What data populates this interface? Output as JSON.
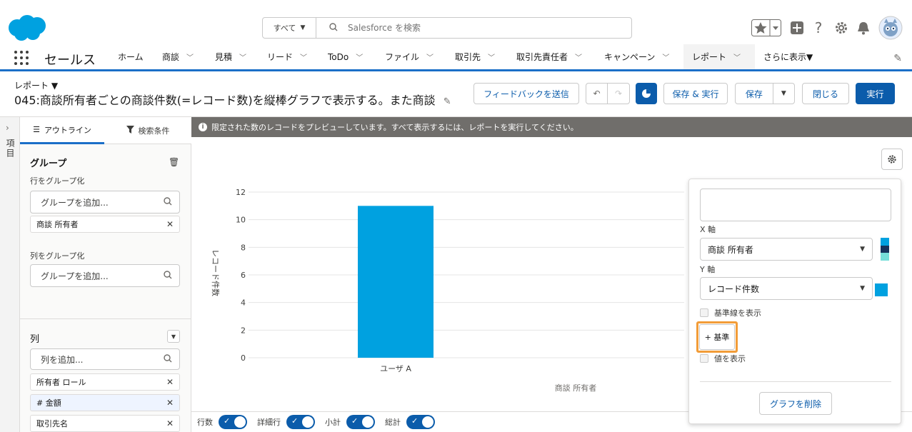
{
  "header": {
    "search_scope": "すべて",
    "search_placeholder": "Salesforce を検索"
  },
  "nav": {
    "app_name": "セールス",
    "items": [
      {
        "label": "ホーム",
        "chevron": false
      },
      {
        "label": "商談",
        "chevron": true
      },
      {
        "label": "見積",
        "chevron": true
      },
      {
        "label": "リード",
        "chevron": true
      },
      {
        "label": "ToDo",
        "chevron": true
      },
      {
        "label": "ファイル",
        "chevron": true
      },
      {
        "label": "取引先",
        "chevron": true
      },
      {
        "label": "取引先責任者",
        "chevron": true
      },
      {
        "label": "キャンペーン",
        "chevron": true
      },
      {
        "label": "レポート",
        "chevron": true,
        "active": true
      },
      {
        "label": "さらに表示▼",
        "chevron": false
      }
    ]
  },
  "report": {
    "type_label": "レポート ▼",
    "title": "045:商談所有者ごとの商談件数(=レコード数)を縦棒グラフで表示する。また商談"
  },
  "toolbar": {
    "feedback": "フィードバックを送信",
    "save_run": "保存 & 実行",
    "save": "保存",
    "close": "閉じる",
    "run": "実行"
  },
  "left_rail": {
    "label": "項目"
  },
  "side_panel": {
    "tab_outline": "アウトライン",
    "tab_filters": "検索条件",
    "group_title": "グループ",
    "row_group_label": "行をグループ化",
    "add_group_placeholder": "グループを追加...",
    "row_groups": [
      "商談 所有者"
    ],
    "col_group_label": "列をグループ化",
    "columns_title": "列",
    "add_column_placeholder": "列を追加...",
    "columns": [
      "所有者 ロール",
      "# 金額",
      "取引先名"
    ]
  },
  "main": {
    "banner": "限定された数のレコードをプレビューしています。すべて表示するには、レポートを実行してください。"
  },
  "bottom": {
    "toggles": [
      "行数",
      "詳細行",
      "小計",
      "総計"
    ]
  },
  "chart_panel": {
    "x_axis_label": "X 軸",
    "x_axis_value": "商談 所有者",
    "y_axis_label": "Y 軸",
    "y_axis_value": "レコード件数",
    "show_baseline": "基準線を表示",
    "add_baseline": "+ 基準",
    "show_values": "値を表示",
    "delete_chart": "グラフを削除",
    "x_colors": [
      "#00a1e0",
      "#16325c",
      "#76ded9"
    ],
    "y_color": "#00a1e0"
  },
  "chart_data": {
    "type": "bar",
    "categories": [
      "ユーザ A"
    ],
    "values": [
      11
    ],
    "ylim": [
      0,
      12
    ],
    "yticks": [
      0,
      2,
      4,
      6,
      8,
      10,
      12
    ],
    "xlabel": "商談 所有者",
    "ylabel": "レコード件数",
    "bar_color": "#00a1e0",
    "grid": true
  }
}
